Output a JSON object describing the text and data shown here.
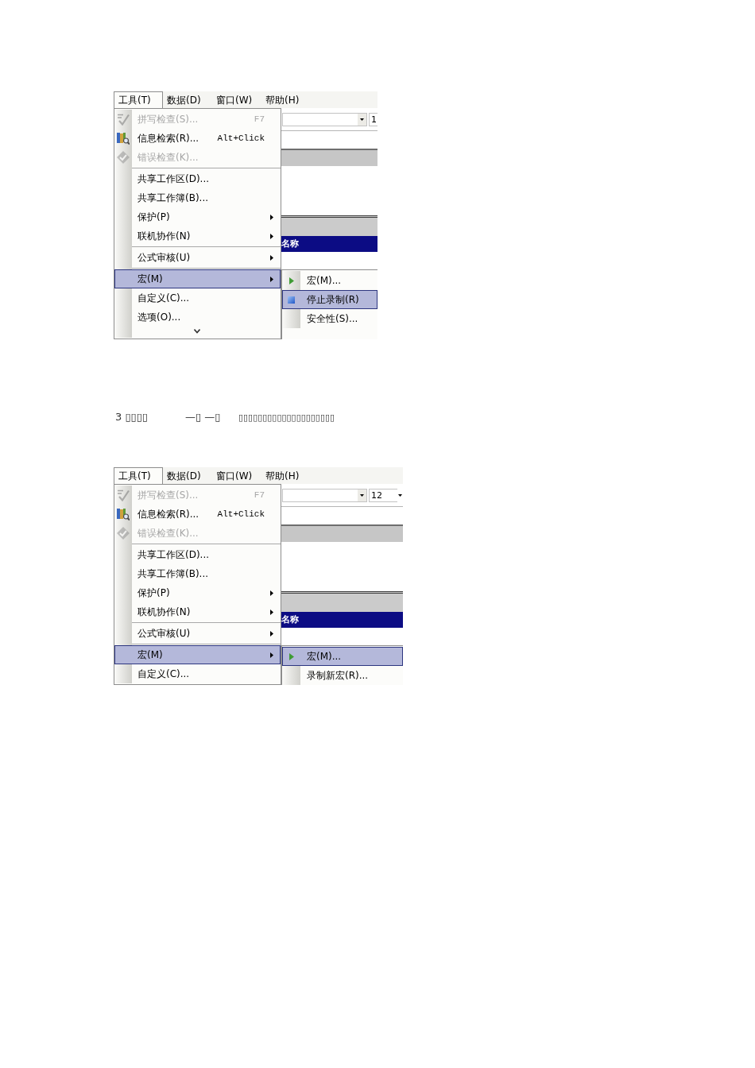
{
  "screenshots": [
    {
      "menu_bar": [
        {
          "label": "工具(T)",
          "selected": true
        },
        {
          "label": "数据(D)",
          "selected": false
        },
        {
          "label": "窗口(W)",
          "selected": false
        },
        {
          "label": "帮助(H)",
          "selected": false
        }
      ],
      "toolbar": {
        "font_size": "1"
      },
      "header_label": "名称",
      "menu": {
        "groups": [
          [
            {
              "label": "拼写检查(S)...",
              "shortcut": "F7",
              "disabled": true,
              "submenu": false,
              "selected": false
            },
            {
              "label": "信息检索(R)...",
              "shortcut": "Alt+Click",
              "disabled": false,
              "submenu": false,
              "selected": false
            },
            {
              "label": "错误检查(K)...",
              "disabled": true,
              "submenu": false,
              "selected": false
            }
          ],
          [
            {
              "label": "共享工作区(D)...",
              "disabled": false,
              "submenu": false,
              "selected": false
            },
            {
              "label": "共享工作簿(B)...",
              "disabled": false,
              "submenu": false,
              "selected": false
            },
            {
              "label": "保护(P)",
              "disabled": false,
              "submenu": true,
              "selected": false
            },
            {
              "label": "联机协作(N)",
              "disabled": false,
              "submenu": true,
              "selected": false
            }
          ],
          [
            {
              "label": "公式审核(U)",
              "disabled": false,
              "submenu": true,
              "selected": false
            }
          ],
          [
            {
              "label": "宏(M)",
              "disabled": false,
              "submenu": true,
              "selected": true
            },
            {
              "label": "自定义(C)...",
              "disabled": false,
              "submenu": false,
              "selected": false
            },
            {
              "label": "选项(O)...",
              "disabled": false,
              "submenu": false,
              "selected": false
            }
          ]
        ],
        "more": true
      },
      "submenu": [
        {
          "label": "宏(M)...",
          "selected": false
        },
        {
          "label": "停止录制(R)",
          "selected": true
        },
        {
          "label": "安全性(S)...",
          "selected": false
        }
      ]
    },
    {
      "menu_bar": [
        {
          "label": "工具(T)",
          "selected": true
        },
        {
          "label": "数据(D)",
          "selected": false
        },
        {
          "label": "窗口(W)",
          "selected": false
        },
        {
          "label": "帮助(H)",
          "selected": false
        }
      ],
      "toolbar": {
        "font_size": "12"
      },
      "header_label": "名称",
      "menu": {
        "groups": [
          [
            {
              "label": "拼写检查(S)...",
              "shortcut": "F7",
              "disabled": true,
              "submenu": false,
              "selected": false
            },
            {
              "label": "信息检索(R)...",
              "shortcut": "Alt+Click",
              "disabled": false,
              "submenu": false,
              "selected": false
            },
            {
              "label": "错误检查(K)...",
              "disabled": true,
              "submenu": false,
              "selected": false
            }
          ],
          [
            {
              "label": "共享工作区(D)...",
              "disabled": false,
              "submenu": false,
              "selected": false
            },
            {
              "label": "共享工作簿(B)...",
              "disabled": false,
              "submenu": false,
              "selected": false
            },
            {
              "label": "保护(P)",
              "disabled": false,
              "submenu": true,
              "selected": false
            },
            {
              "label": "联机协作(N)",
              "disabled": false,
              "submenu": true,
              "selected": false
            }
          ],
          [
            {
              "label": "公式审核(U)",
              "disabled": false,
              "submenu": true,
              "selected": false
            }
          ],
          [
            {
              "label": "宏(M)",
              "disabled": false,
              "submenu": true,
              "selected": true
            },
            {
              "label": "自定义(C)...",
              "disabled": false,
              "submenu": false,
              "selected": false
            }
          ]
        ]
      },
      "submenu": [
        {
          "label": "宏(M)...",
          "selected": true
        },
        {
          "label": "录制新宏(R)...",
          "selected": false
        }
      ]
    }
  ],
  "caption": [
    "3 ▯▯▯▯",
    "—▯ —▯",
    "▯▯▯▯▯▯▯▯▯▯▯▯▯▯▯▯▯▯▯▯"
  ]
}
